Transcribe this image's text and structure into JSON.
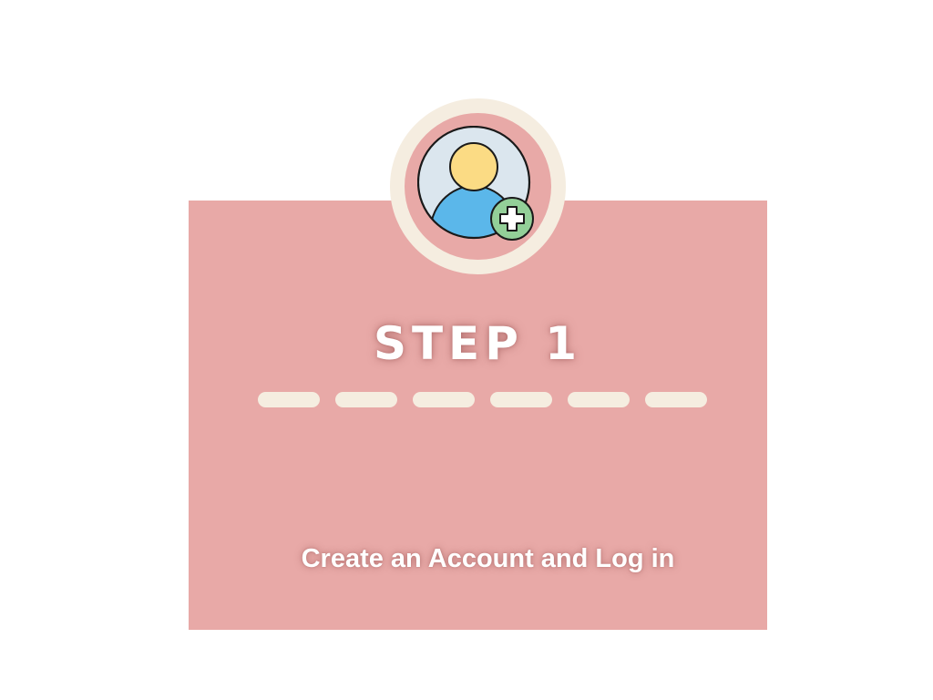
{
  "step": {
    "title": "STEP 1",
    "description": "Create an Account and Log in",
    "icon": "add-user-icon"
  },
  "colors": {
    "card": "#e8a9a7",
    "ring": "#f5ede0",
    "dash": "#f5ede0",
    "avatar_bg": "#dbe6ee",
    "avatar_head": "#fbdb84",
    "avatar_body": "#5bb7ea",
    "plus_bg": "#93cf98"
  }
}
